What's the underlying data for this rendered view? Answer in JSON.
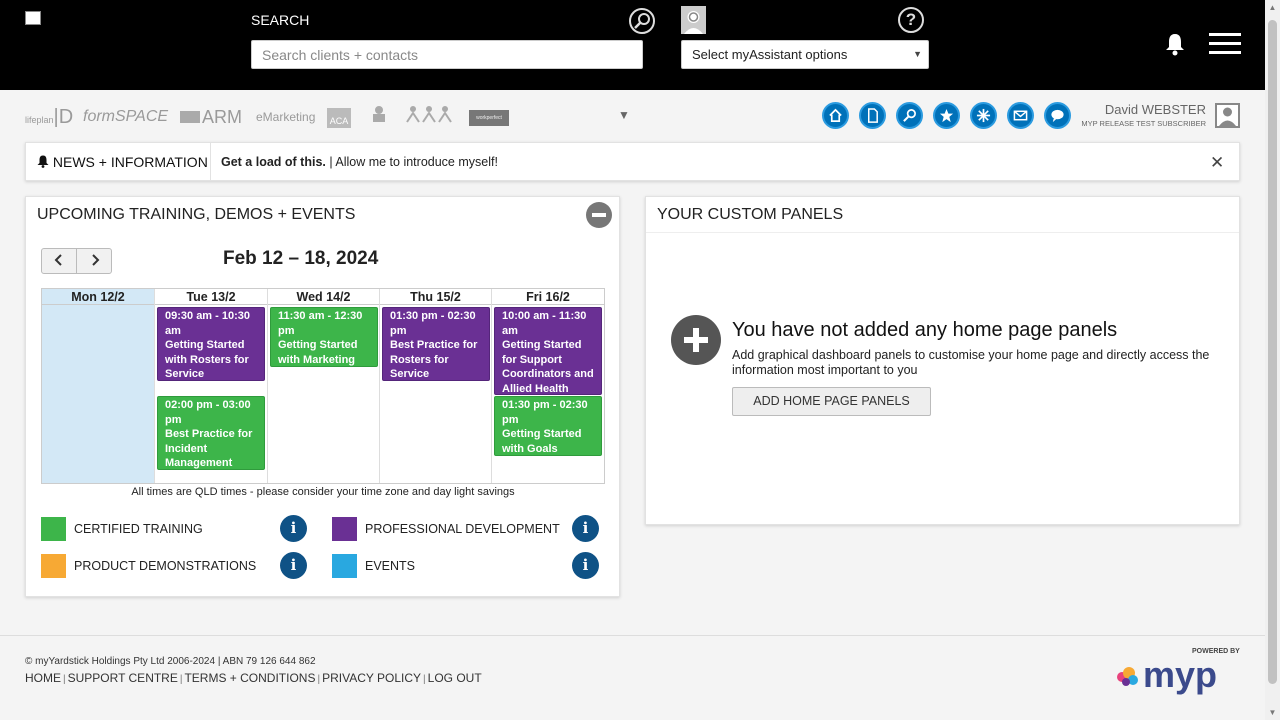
{
  "header": {
    "search_label": "SEARCH",
    "search_placeholder": "Search clients + contacts",
    "assistant_select": "Select myAssistant options",
    "help": "?"
  },
  "products": [
    "lifeplan",
    "formSPACE",
    "ARM",
    "eMarketing",
    "ACA",
    "",
    "",
    "workperfect"
  ],
  "user": {
    "name": "David WEBSTER",
    "subtitle": "MYP RELEASE TEST SUBSCRIBER"
  },
  "news": {
    "label": "NEWS + INFORMATION",
    "headline": "Get a load of this.",
    "text": " | Allow me to introduce myself!"
  },
  "training_panel": {
    "title": "UPCOMING TRAINING, DEMOS + EVENTS",
    "prev": "‹",
    "next": "›",
    "range": "Feb 12 – 18, 2024",
    "days": [
      "Mon 12/2",
      "Tue 13/2",
      "Wed 14/2",
      "Thu 15/2",
      "Fri 16/2"
    ],
    "events": [
      {
        "day": "Tue 13/2",
        "time": "09:30 am - 10:30 am",
        "title": "Getting Started with Rosters for Service Providers",
        "category": "PROFESSIONAL DEVELOPMENT"
      },
      {
        "day": "Tue 13/2",
        "time": "02:00 pm - 03:00 pm",
        "title": "Best Practice for Incident Management",
        "category": "CERTIFIED TRAINING"
      },
      {
        "day": "Wed 14/2",
        "time": "11:30 am - 12:30 pm",
        "title": "Getting Started with Marketing",
        "category": "CERTIFIED TRAINING"
      },
      {
        "day": "Thu 15/2",
        "time": "01:30 pm - 02:30 pm",
        "title": "Best Practice for Rosters for Service Providers",
        "category": "PROFESSIONAL DEVELOPMENT"
      },
      {
        "day": "Fri 16/2",
        "time": "10:00 am - 11:30 am",
        "title": "Getting Started for Support Coordinators and Allied Health",
        "category": "PROFESSIONAL DEVELOPMENT"
      },
      {
        "day": "Fri 16/2",
        "time": "01:30 pm - 02:30 pm",
        "title": "Getting Started with Goals",
        "category": "CERTIFIED TRAINING"
      }
    ],
    "tz_note": "All times are QLD times - please consider your time zone and day light savings",
    "legend": [
      {
        "label": "CERTIFIED TRAINING",
        "color": "#3db54a"
      },
      {
        "label": "PROFESSIONAL DEVELOPMENT",
        "color": "#6a3094"
      },
      {
        "label": "PRODUCT DEMONSTRATIONS",
        "color": "#f7a934"
      },
      {
        "label": "EVENTS",
        "color": "#29a8e0"
      }
    ],
    "info": "i"
  },
  "custom_panel": {
    "title": "YOUR CUSTOM PANELS",
    "empty_title": "You have not added any home page panels",
    "empty_desc": "Add graphical dashboard panels to customise your home page and directly access the information most important to you",
    "button": "ADD HOME PAGE PANELS"
  },
  "footer": {
    "copyright": "© myYardstick Holdings Pty Ltd 2006-2024 | ABN 79 126 644 862",
    "links": [
      "HOME",
      "SUPPORT CENTRE",
      "TERMS + CONDITIONS",
      "PRIVACY POLICY",
      "LOG OUT"
    ],
    "powered_by": "POWERED BY",
    "brand": "myp"
  },
  "colors": {
    "accent": "#0071b9",
    "purple": "#6a3094",
    "green": "#3db54a",
    "today": "#d3e8f6"
  }
}
